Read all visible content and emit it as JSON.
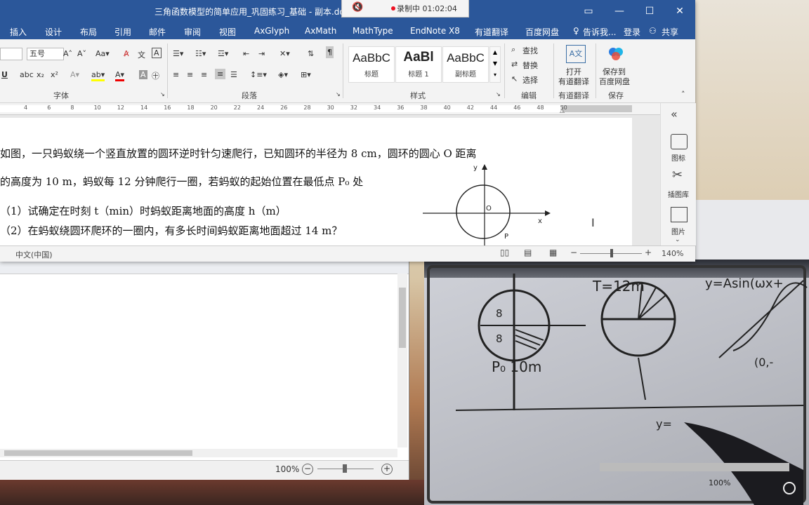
{
  "window": {
    "title": "三角函数模型的简单应用_巩固练习_基础 - 副本.doc [",
    "recording": "录制中 01:02:04"
  },
  "menu": [
    "插入",
    "设计",
    "布局",
    "引用",
    "邮件",
    "审阅",
    "视图",
    "AxGlyph",
    "AxMath",
    "MathType",
    "EndNote X8",
    "有道翻译",
    "百度网盘",
    "告诉我...",
    "登录",
    "共享"
  ],
  "ribbon": {
    "font_size": "五号",
    "group_font": "字体",
    "group_paragraph": "段落",
    "group_styles": "样式",
    "group_edit": "编辑",
    "group_youdao": "有道翻译",
    "group_save": "保存",
    "styles": [
      {
        "preview": "AaBbC",
        "name": "标题"
      },
      {
        "preview": "AaBl",
        "name": "标题 1"
      },
      {
        "preview": "AaBbC",
        "name": "副标题"
      }
    ],
    "find": "查找",
    "replace": "替换",
    "select": "选择",
    "open_youdao": "打开\n有道翻译",
    "open_youdao_1": "打开",
    "open_youdao_2": "有道翻译",
    "save_baidu_1": "保存到",
    "save_baidu_2": "百度网盘"
  },
  "ruler_numbers": [
    "4",
    "6",
    "8",
    "10",
    "12",
    "14",
    "16",
    "18",
    "20",
    "22",
    "24",
    "26",
    "28",
    "30",
    "32",
    "34",
    "36",
    "38",
    "40",
    "42",
    "44",
    "46",
    "48",
    "50"
  ],
  "document": {
    "line1": "如图，一只蚂蚁绕一个竖直放置的圆环逆时针匀速爬行，已知圆环的半径为 8 cm，圆环的圆心 O 距离",
    "line2": "的高度为 10 m，蚂蚁每 12 分钟爬行一圈，若蚂蚁的起始位置在最低点 P₀ 处",
    "line3": "（1）试确定在时刻 t（min）时蚂蚁距离地面的高度 h（m）",
    "line4": "（2）在蚂蚁绕圆环爬环的一圈内，有多长时间蚂蚁距离地面超过 14 m？",
    "figure": {
      "y_label": "y",
      "x_label": "x",
      "o_label": "O",
      "p_label": "P"
    }
  },
  "statusbar": {
    "language": "中文(中国)",
    "zoom": "140%"
  },
  "sidepane": [
    "图标",
    "插图库",
    "图片"
  ],
  "win2": {
    "zoom": "100%"
  },
  "video": {
    "zoom": "100%"
  }
}
